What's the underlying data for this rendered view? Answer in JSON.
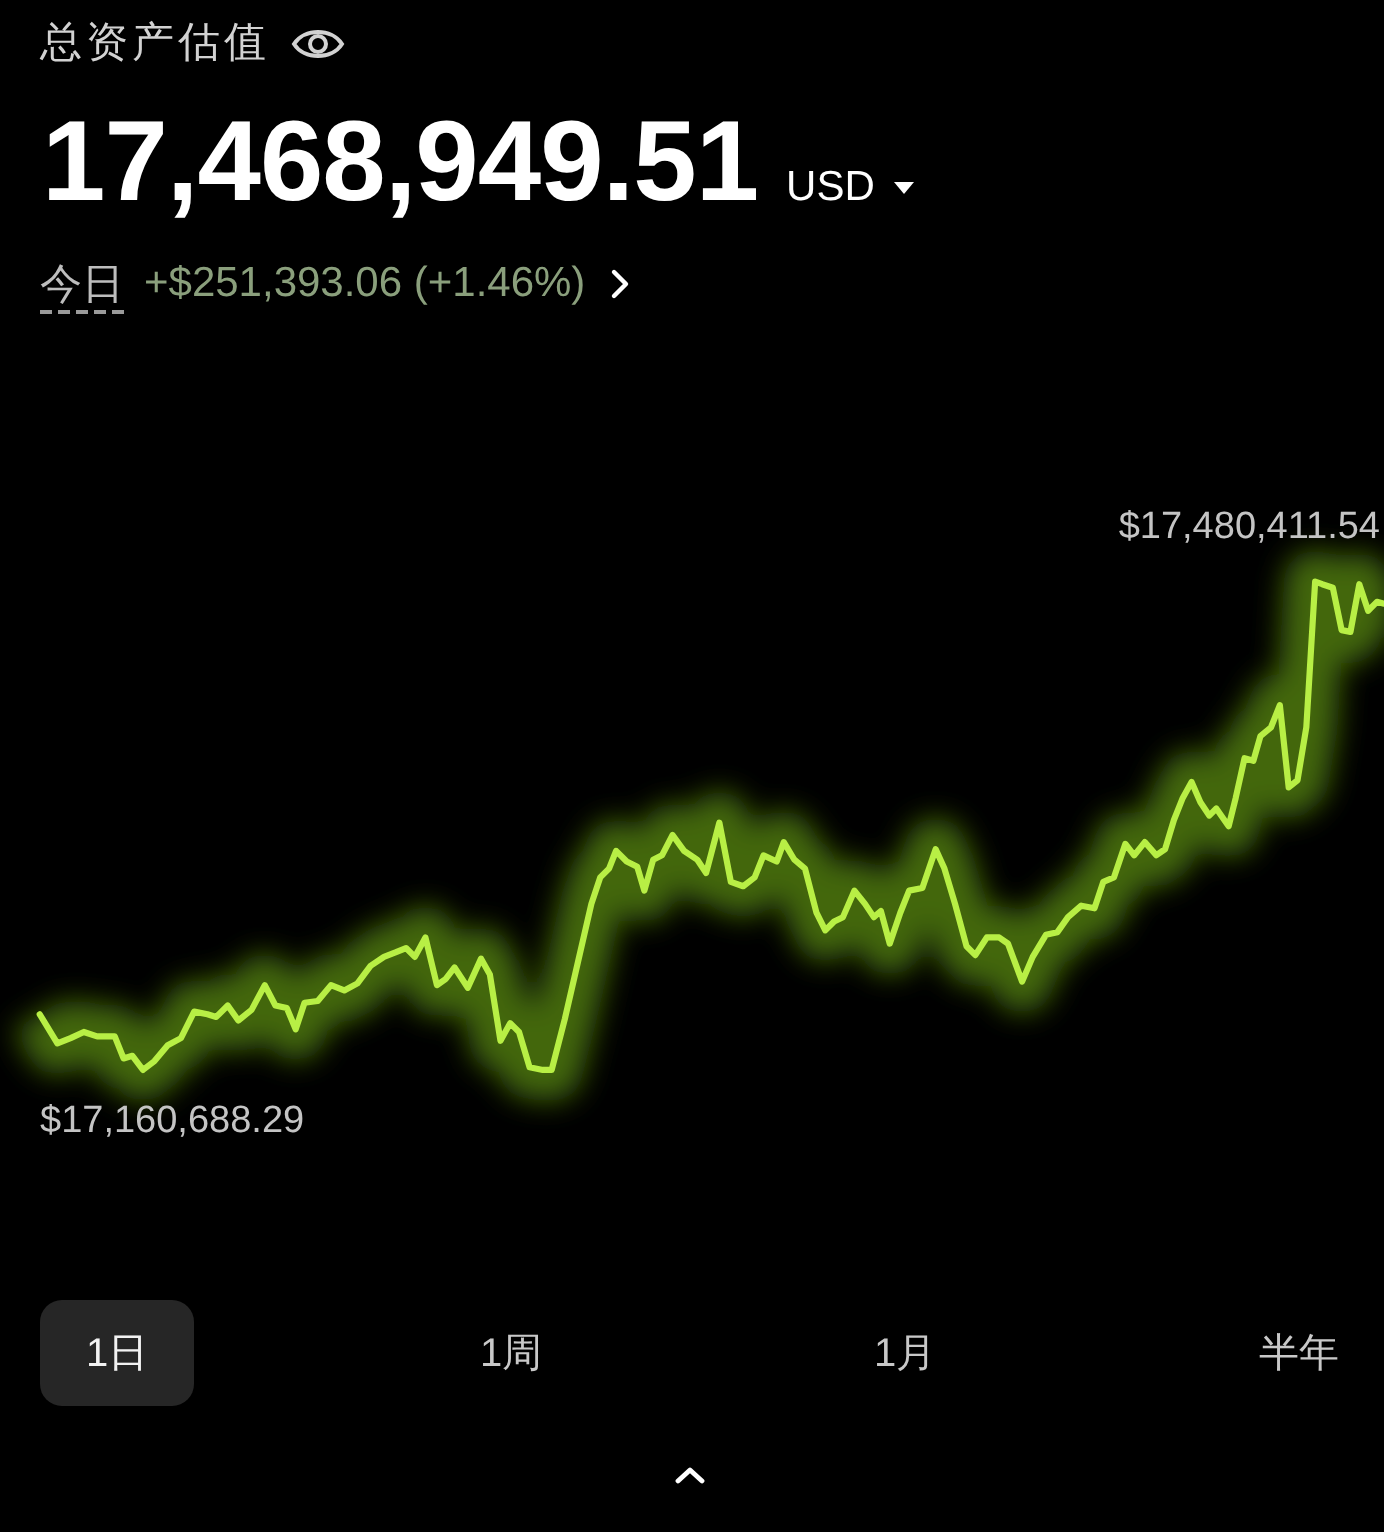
{
  "header": {
    "title": "总资产估值",
    "total": "17,468,949.51",
    "currency": "USD",
    "today_label": "今日",
    "today_change": "+$251,393.06 (+1.46%)"
  },
  "chart": {
    "max_label": "$17,480,411.54",
    "min_label": "$17,160,688.29"
  },
  "periods": [
    {
      "label": "1日",
      "selected": true
    },
    {
      "label": "1周",
      "selected": false
    },
    {
      "label": "1月",
      "selected": false
    },
    {
      "label": "半年",
      "selected": false
    }
  ]
}
